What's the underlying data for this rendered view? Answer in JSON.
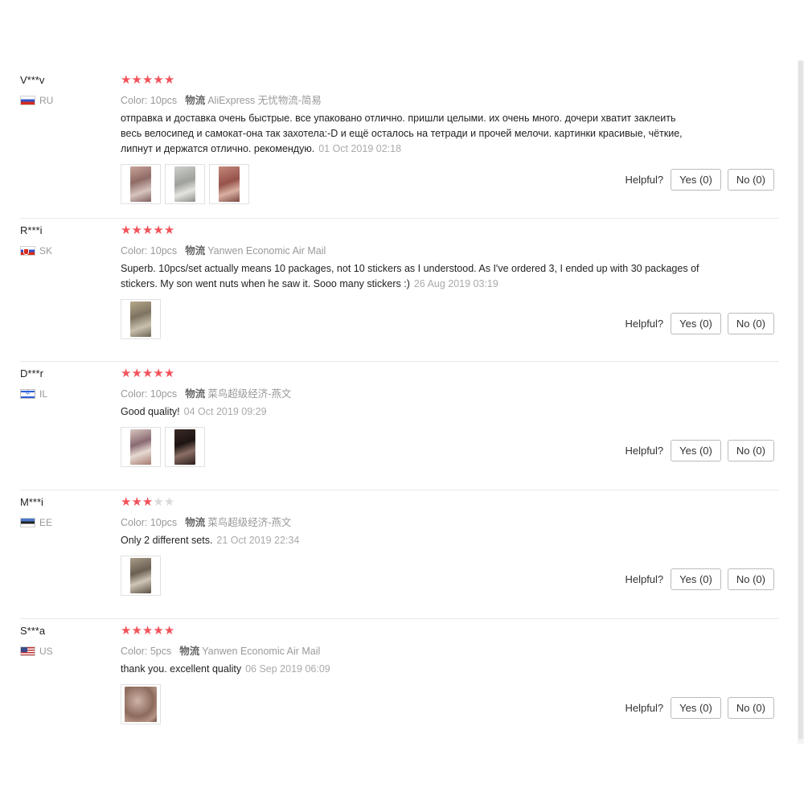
{
  "helpful_label": "Helpful?",
  "star_color": "#f2535b",
  "star_off_color": "#d9d9d9",
  "reviews": [
    {
      "user": "V***v",
      "country": "RU",
      "rating": 5,
      "color": "Color: 10pcs",
      "logistics_label": "物流",
      "logistics": "AliExpress 无忧物流-简易",
      "text": "отправка и доставка очень быстрые. все упаковано отлично. пришли целыми. их очень много. дочери хватит заклеить весь велосипед и самокат-она так захотела:-D и ещё осталось на тетради и прочей мелочи. картинки красивые, чёткие, липнут и держатся отлично. рекомендую.",
      "date": "01 Oct 2019 02:18",
      "yes": "Yes (0)",
      "no": "No (0)"
    },
    {
      "user": "R***i",
      "country": "SK",
      "rating": 5,
      "color": "Color: 10pcs",
      "logistics_label": "物流",
      "logistics": "Yanwen Economic Air Mail",
      "text": "Superb. 10pcs/set actually means 10 packages, not 10 stickers as I understood. As I've ordered 3, I ended up with 30 packages of stickers. My son went nuts when he saw it. Sooo many stickers :)",
      "date": "26 Aug 2019 03:19",
      "yes": "Yes (0)",
      "no": "No (0)"
    },
    {
      "user": "D***r",
      "country": "IL",
      "rating": 5,
      "color": "Color: 10pcs",
      "logistics_label": "物流",
      "logistics": "菜鸟超级经济-燕文",
      "text": "Good quality!",
      "date": "04 Oct 2019 09:29",
      "yes": "Yes (0)",
      "no": "No (0)"
    },
    {
      "user": "M***i",
      "country": "EE",
      "rating": 3,
      "color": "Color: 10pcs",
      "logistics_label": "物流",
      "logistics": "菜鸟超级经济-燕文",
      "text": "Only 2 different sets.",
      "date": "21 Oct 2019 22:34",
      "yes": "Yes (0)",
      "no": "No (0)"
    },
    {
      "user": "S***a",
      "country": "US",
      "rating": 5,
      "color": "Color: 5pcs",
      "logistics_label": "物流",
      "logistics": "Yanwen Economic Air Mail",
      "text": "thank you. excellent quality",
      "date": "06 Sep 2019 06:09",
      "yes": "Yes (0)",
      "no": "No (0)"
    }
  ]
}
